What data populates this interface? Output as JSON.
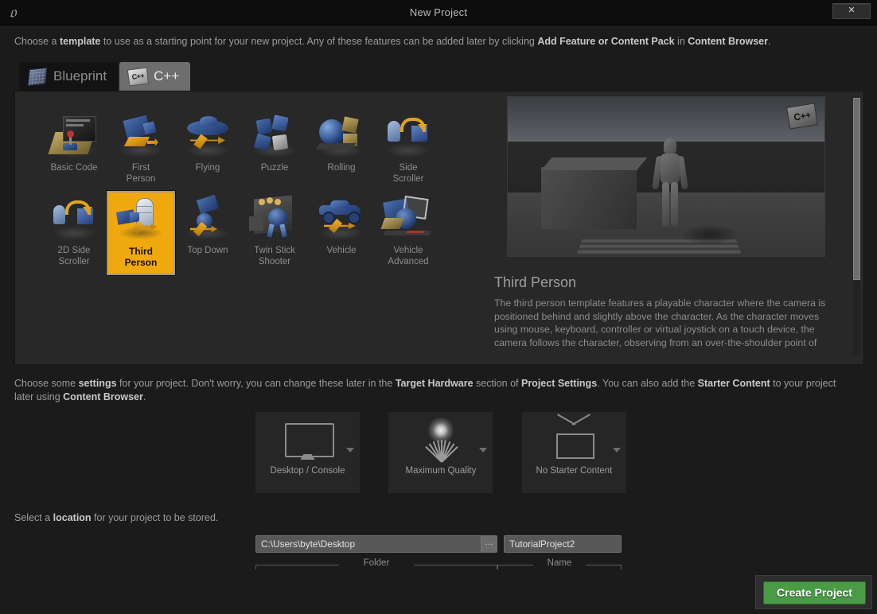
{
  "window": {
    "title": "New Project",
    "logo_icon": "unreal-engine-logo",
    "close_label": "✕"
  },
  "intro": {
    "part1": "Choose a ",
    "bold1": "template",
    "part2": " to use as a starting point for your new project.  Any of these features can be added later by clicking ",
    "bold2": "Add Feature or Content Pack",
    "part3": " in ",
    "bold3": "Content Browser",
    "part4": "."
  },
  "tabs": [
    {
      "label": "Blueprint",
      "icon": "blueprint-icon",
      "active": false
    },
    {
      "label": "C++",
      "icon": "cpp-icon",
      "active": true,
      "icon_text": "C++"
    }
  ],
  "templates": {
    "selected": "Third Person",
    "items": [
      {
        "name": "Basic Code",
        "label": "Basic Code",
        "selected": false
      },
      {
        "name": "First Person",
        "label": "First\nPerson",
        "selected": false
      },
      {
        "name": "Flying",
        "label": "Flying",
        "selected": false
      },
      {
        "name": "Puzzle",
        "label": "Puzzle",
        "selected": false
      },
      {
        "name": "Rolling",
        "label": "Rolling",
        "selected": false
      },
      {
        "name": "Side Scroller",
        "label": "Side\nScroller",
        "selected": false
      },
      {
        "name": "2D Side Scroller",
        "label": "2D Side\nScroller",
        "selected": false
      },
      {
        "name": "Third Person",
        "label": "Third\nPerson",
        "selected": true
      },
      {
        "name": "Top Down",
        "label": "Top Down",
        "selected": false
      },
      {
        "name": "Twin Stick Shooter",
        "label": "Twin Stick\nShooter",
        "selected": false
      },
      {
        "name": "Vehicle",
        "label": "Vehicle",
        "selected": false
      },
      {
        "name": "Vehicle Advanced",
        "label": "Vehicle\nAdvanced",
        "selected": false
      }
    ]
  },
  "preview": {
    "badge": "C++",
    "title": "Third Person",
    "description": "The third person template features a playable character where the camera is positioned behind and slightly above the character. As the character moves using mouse, keyboard, controller or virtual joystick on a touch device, the camera follows the character, observing from an over-the-shoulder point of view. This perspective emphasizes the main character and is popular in action and adventure games. The"
  },
  "settings_intro": {
    "part1": "Choose some ",
    "bold1": "settings",
    "part2": " for your project.  Don't worry, you can change these later in the ",
    "bold2": "Target Hardware",
    "part3": " section of ",
    "bold3": "Project Settings",
    "part4": ".  You can also add the ",
    "bold4": "Starter Content",
    "part5": " to your project later using ",
    "bold5": "Content Browser",
    "part6": "."
  },
  "settings": [
    {
      "label": "Desktop / Console",
      "icon": "monitor-icon"
    },
    {
      "label": "Maximum Quality",
      "icon": "quality-grass-sun-icon"
    },
    {
      "label": "No Starter Content",
      "icon": "house-icon"
    }
  ],
  "location": {
    "part1": "Select a ",
    "bold1": "location",
    "part2": " for your project to be stored.",
    "folder_value": "C:\\Users\\byte\\Desktop",
    "browse_label": "…",
    "name_value": "TutorialProject2",
    "folder_caption": "Folder",
    "name_caption": "Name"
  },
  "actions": {
    "create_label": "Create Project"
  },
  "colors": {
    "background": "#1b1b1b",
    "panel": "#282828",
    "selected_tile": "#efa80e",
    "create_button": "#4a9b46",
    "text": "#9b9b9b"
  }
}
